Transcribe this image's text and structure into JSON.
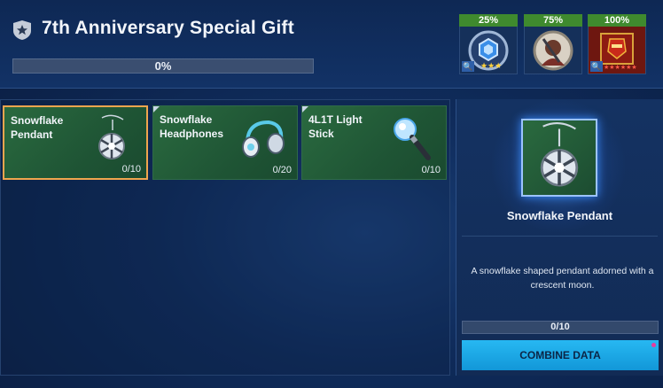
{
  "header": {
    "title": "7th Anniversary Special Gift",
    "progress_label": "0%",
    "progress_value": 0
  },
  "milestones": [
    {
      "label": "25%",
      "icon": "crystal-badge-icon",
      "value": 0.25
    },
    {
      "label": "75%",
      "icon": "warrior-portrait-icon",
      "value": 0.75
    },
    {
      "label": "100%",
      "icon": "armored-hero-portrait-icon",
      "value": 1.0
    }
  ],
  "items": [
    {
      "name": "Snowflake Pendant",
      "count": "0/10",
      "icon": "snowflake-pendant-icon"
    },
    {
      "name": "Snowflake Headphones",
      "count": "0/20",
      "icon": "headphones-icon"
    },
    {
      "name": "4L1T Light Stick",
      "count": "0/10",
      "icon": "light-stick-icon"
    }
  ],
  "detail": {
    "name": "Snowflake Pendant",
    "description": "A snowflake shaped pendant adorned with a crescent moon.",
    "progress": "0/10",
    "combine_label": "COMBINE DATA"
  },
  "colors": {
    "background": "#0f2b5a",
    "item_green": "#1f5535",
    "selected_border": "#f0a54e",
    "milestone_green": "#3f8a2e",
    "button_blue": "#1fa8e6"
  }
}
